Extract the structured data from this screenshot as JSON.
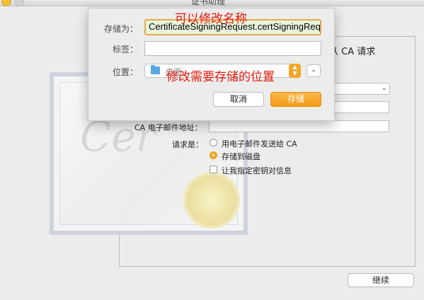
{
  "window": {
    "title": "证书助理"
  },
  "panel": {
    "header": "从 CA 请求"
  },
  "form": {
    "ca_email_label": "CA 电子邮件地址：",
    "request_label": "请求是：",
    "options": [
      {
        "label": "用电子邮件发送给 CA",
        "selected": false
      },
      {
        "label": "存储到磁盘",
        "selected": true
      }
    ],
    "specify_key_label": "让我指定密钥对信息"
  },
  "sheet": {
    "save_as_label": "存储为：",
    "save_as_value": "CertificateSigningRequest.certSigningRequest",
    "tags_label": "标签：",
    "tags_value": "",
    "location_label": "位置：",
    "location_value": "桌面",
    "cancel_label": "取消",
    "save_label": "存储"
  },
  "annotations": {
    "rename": "可以修改名称",
    "location": "修改需要存储的位置"
  },
  "footer": {
    "continue_label": "继续"
  },
  "colors": {
    "accent": "#f5a623",
    "annotation": "#e8180c",
    "filename_highlight": "#e8f5dc"
  }
}
